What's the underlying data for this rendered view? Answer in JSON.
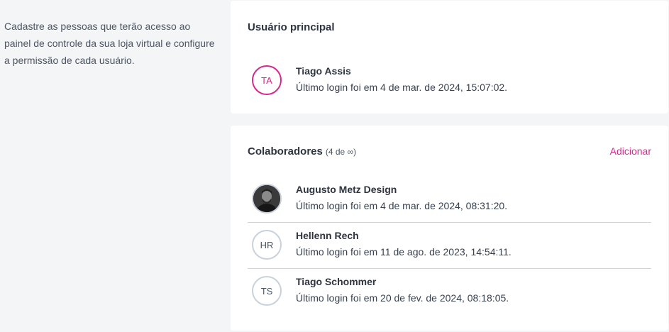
{
  "description": "Cadastre as pessoas que terão acesso ao painel de controle da sua loja virtual e configure a permissão de cada usuário.",
  "main_user": {
    "title": "Usuário principal",
    "initials": "TA",
    "name": "Tiago Assis",
    "last_login": "Último login foi em 4 de mar. de 2024, 15:07:02."
  },
  "collaborators": {
    "title": "Colaboradores",
    "count": "(4 de ∞)",
    "add_label": "Adicionar",
    "items": [
      {
        "initials": "",
        "avatar": "photo",
        "name": "Augusto Metz Design",
        "last_login": "Último login foi em 4 de mar. de 2024, 08:31:20."
      },
      {
        "initials": "HR",
        "avatar": "initials",
        "name": "Hellenn Rech",
        "last_login": "Último login foi em 11 de ago. de 2023, 14:54:11."
      },
      {
        "initials": "TS",
        "avatar": "initials",
        "name": "Tiago Schommer",
        "last_login": "Último login foi em 20 de fev. de 2024, 08:18:05."
      }
    ]
  },
  "colors": {
    "accent": "#d9288c",
    "avatar_border": "#c9d2dc"
  }
}
